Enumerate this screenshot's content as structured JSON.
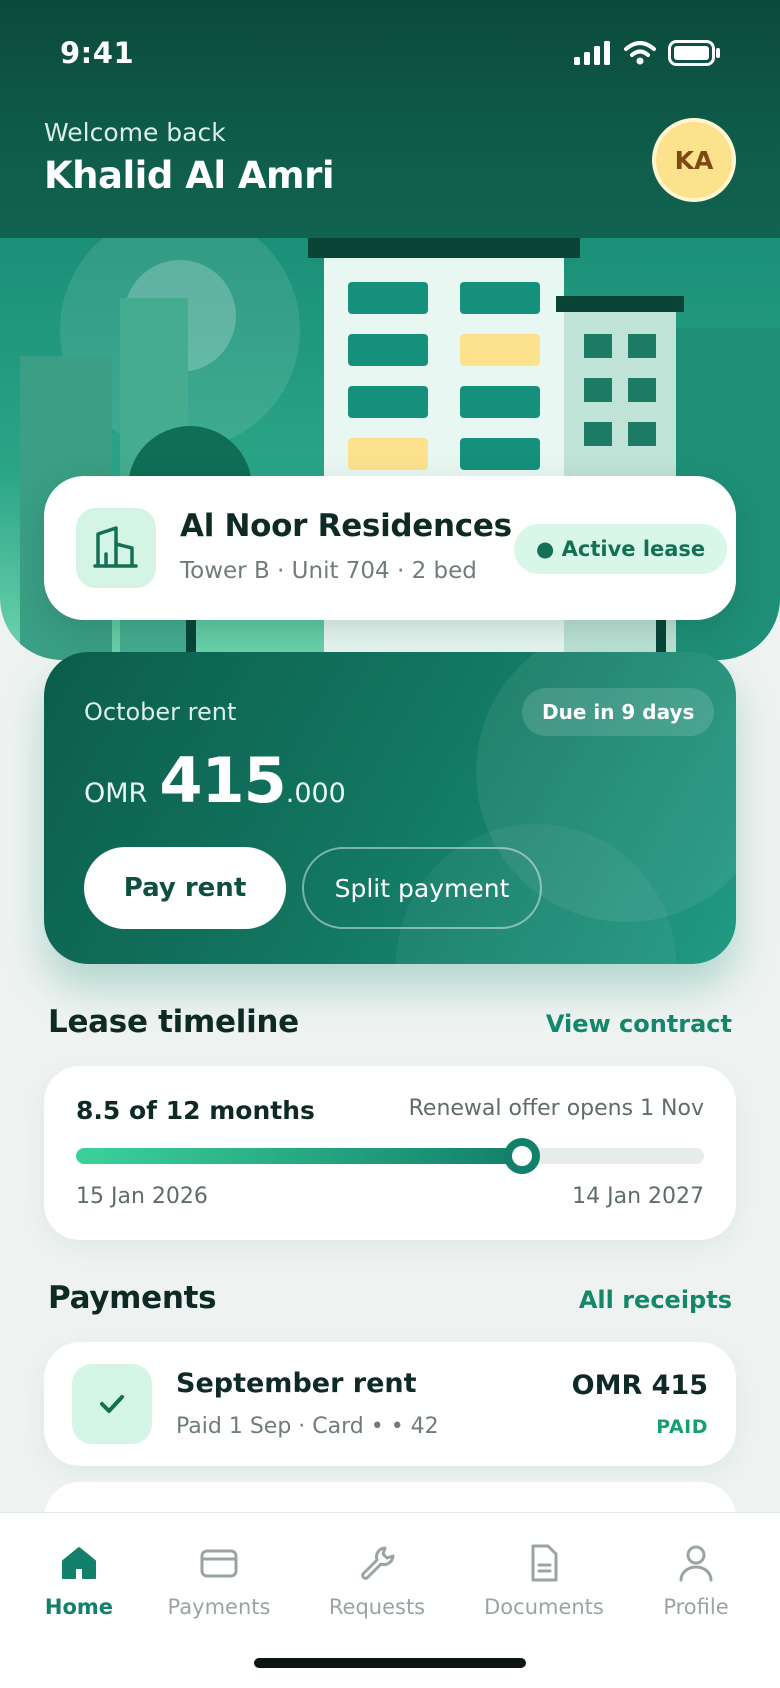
{
  "status_bar": {
    "time": "9:41"
  },
  "header": {
    "welcome": "Welcome back",
    "user_name": "Khalid Al Amri",
    "avatar_initials": "KA"
  },
  "property": {
    "name": "Al Noor Residences",
    "details": "Tower B · Unit 704 · 2 bed",
    "status": "● Active lease"
  },
  "rent": {
    "label": "October rent",
    "due": "Due in 9 days",
    "currency": "OMR",
    "amount_main": "415",
    "amount_decimals": ".000",
    "pay_button": "Pay rent",
    "split_button": "Split payment"
  },
  "lease_timeline": {
    "title": "Lease timeline",
    "link": "View contract",
    "progress_text": "8.5 of 12 months",
    "progress_fraction": 0.71,
    "note": "Renewal offer opens 1 Nov",
    "start": "15 Jan 2026",
    "end": "14 Jan 2027"
  },
  "payments": {
    "title": "Payments",
    "link": "All receipts",
    "items": [
      {
        "title": "September rent",
        "subtitle": "Paid 1 Sep · Card • • 42",
        "amount": "OMR 415",
        "status": "PAID"
      }
    ]
  },
  "tabbar": {
    "items": [
      {
        "label": "Home",
        "icon": "home-icon",
        "active": true
      },
      {
        "label": "Payments",
        "icon": "card-icon"
      },
      {
        "label": "Requests",
        "icon": "wrench-icon"
      },
      {
        "label": "Documents",
        "icon": "document-icon"
      },
      {
        "label": "Profile",
        "icon": "person-icon"
      }
    ]
  },
  "colors": {
    "brand_dark": "#0b4a3b",
    "brand": "#12806a",
    "accent_yellow": "#fde28d",
    "paid_green": "#16a06e"
  }
}
